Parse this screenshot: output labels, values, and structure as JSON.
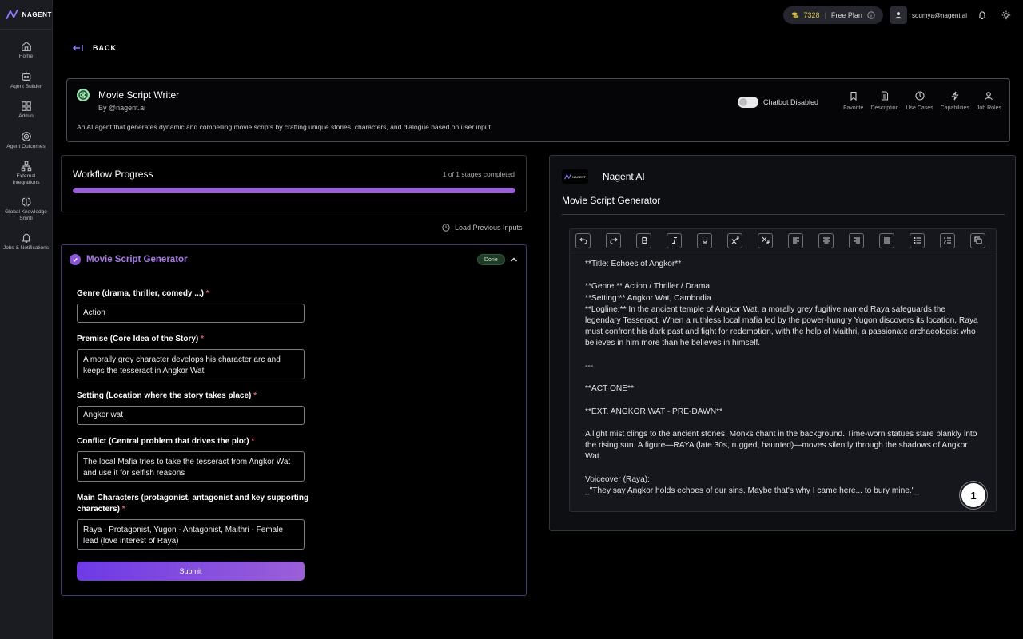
{
  "brand": {
    "logo_text": "NAGENT"
  },
  "sidebar": {
    "items": [
      {
        "label": "Home"
      },
      {
        "label": "Agent Builder"
      },
      {
        "label": "Admin"
      },
      {
        "label": "Agent Outcomes"
      },
      {
        "label": "External Integrations"
      },
      {
        "label": "Global Knowledge Smriti"
      },
      {
        "label": "Jobs & Notifications"
      }
    ]
  },
  "header": {
    "credits": "7328",
    "plan": "Free Plan",
    "user_email": "soumya@nagent.ai"
  },
  "back_label": "BACK",
  "agent": {
    "name": "Movie Script Writer",
    "by": "By @nagent.ai",
    "description": "An AI agent that generates dynamic and compelling movie scripts by crafting unique stories, characters, and dialogue based on user input.",
    "chatbot_status": "Chatbot Disabled",
    "actions": [
      {
        "label": "Favorite",
        "icon": "bookmark-icon"
      },
      {
        "label": "Description",
        "icon": "document-icon"
      },
      {
        "label": "Use Cases",
        "icon": "clock-icon"
      },
      {
        "label": "Capabilities",
        "icon": "lightning-icon"
      },
      {
        "label": "Job Roles",
        "icon": "person-icon"
      }
    ]
  },
  "workflow": {
    "title": "Workflow Progress",
    "status": "1 of 1 stages completed",
    "progress": 1.0
  },
  "load_previous": "Load Previous Inputs",
  "form": {
    "title": "Movie Script Generator",
    "badge": "Done",
    "fields": [
      {
        "label": "Genre (drama, thriller, comedy ...)",
        "value": "Action"
      },
      {
        "label": "Premise (Core Idea of the Story)",
        "value": "A morally grey character develops his character arc and keeps the tesseract in Angkor Wat"
      },
      {
        "label": "Setting (Location where the story takes place)",
        "value": "Angkor wat"
      },
      {
        "label": "Conflict (Central problem that drives the plot)",
        "value": "The local Mafia tries to take the tesseract from Angkor Wat and use it for selfish reasons"
      },
      {
        "label": "Main Characters (protagonist, antagonist and key supporting characters)",
        "value": "Raya - Protagonist, Yugon - Antagonist, Maithri - Female lead (love interest of Raya)"
      }
    ],
    "submit_label": "Submit"
  },
  "output": {
    "logo_text": "NAGENT",
    "brand": "Nagent AI",
    "title": "Movie Script Generator",
    "badge_count": "1",
    "lines": [
      "**Title: Echoes of Angkor**",
      "",
      "**Genre:** Action / Thriller / Drama",
      "**Setting:** Angkor Wat, Cambodia",
      "**Logline:** In the ancient temple of Angkor Wat, a morally grey fugitive named Raya safeguards the legendary Tesseract. When a ruthless local mafia led by the power-hungry Yugon discovers its location, Raya must confront his dark past and fight for redemption, with the help of Maithri, a passionate archaeologist who believes in him more than he believes in himself.",
      "",
      "---",
      "",
      "**ACT ONE**",
      "",
      "**EXT. ANGKOR WAT - PRE-DAWN**",
      "",
      "A light mist clings to the ancient stones. Monks chant in the background. Time-worn statues stare blankly into the rising sun. A figure—RAYA (late 30s, rugged, haunted)—moves silently through the shadows of Angkor Wat.",
      "",
      "Voiceover (Raya):",
      "_\"They say Angkor holds echoes of our sins. Maybe that's why I came here... to bury mine.\"_"
    ]
  },
  "colors": {
    "accent": "#9a5fd8",
    "done_badge": "#1f3a27",
    "required": "#e05a6a"
  }
}
